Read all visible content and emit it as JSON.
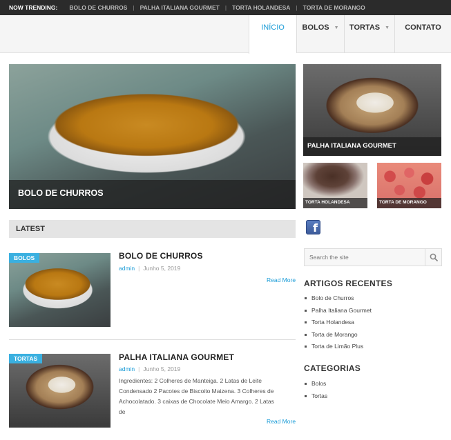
{
  "trending": {
    "label": "NOW TRENDING:",
    "items": [
      "BOLO DE CHURROS",
      "PALHA ITALIANA GOURMET",
      "TORTA HOLANDESA",
      "TORTA DE MORANGO"
    ]
  },
  "nav": {
    "items": [
      {
        "label": "INÍCIO"
      },
      {
        "label": "BOLOS"
      },
      {
        "label": "TORTAS"
      },
      {
        "label": "CONTATO"
      }
    ],
    "caret": "▼"
  },
  "featured": {
    "main": {
      "title": "BOLO DE CHURROS"
    },
    "side": {
      "title": "PALHA ITALIANA GOURMET"
    },
    "small": [
      {
        "title": "TORTA HOLANDESA"
      },
      {
        "title": "TORTA DE MORANGO"
      }
    ]
  },
  "latest": {
    "heading": "LATEST",
    "posts": [
      {
        "category": "BOLOS",
        "title": "BOLO DE CHURROS",
        "author": "admin",
        "date": "Junho 5, 2019",
        "excerpt_lines": [],
        "read_more": "Read More"
      },
      {
        "category": "TORTAS",
        "title": "PALHA ITALIANA GOURMET",
        "author": "admin",
        "date": "Junho 5, 2019",
        "excerpt_lines": [
          "Ingredientes: 2 Colheres de Manteiga. 2 Latas de Leite",
          "Condensado 2 Pacotes de Biscoito Maizena. 3 Colheres de",
          "Achocolatado. 3 caixas de Chocolate Meio Amargo. 2 Latas",
          "de"
        ],
        "read_more": "Read More"
      }
    ]
  },
  "sidebar": {
    "facebook_letter": "f",
    "search_placeholder": "Search the site",
    "recent": {
      "title": "ARTIGOS RECENTES",
      "items": [
        "Bolo de Churros",
        "Palha Italiana Gourmet",
        "Torta Holandesa",
        "Torta de Morango",
        "Torta de Limão Plus"
      ]
    },
    "categories": {
      "title": "CATEGORIAS",
      "items": [
        "Bolos",
        "Tortas"
      ]
    }
  },
  "colors": {
    "accent": "#1a9cd7",
    "badge": "#3ab0e0",
    "topbar": "#2b2b2b",
    "facebook": "#3b5998"
  }
}
